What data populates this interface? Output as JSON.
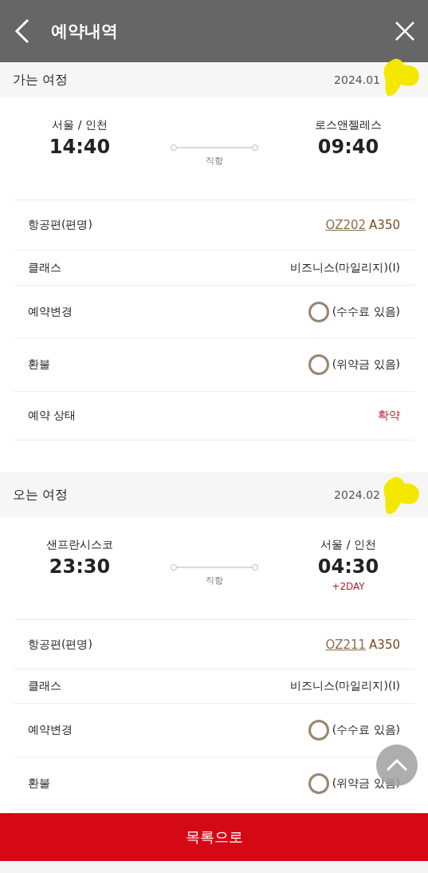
{
  "header": {
    "title": "예약내역"
  },
  "journeys": [
    {
      "title": "가는 여정",
      "date": "2024.01",
      "from": {
        "city": "서울 / 인천",
        "time": "14:40"
      },
      "to": {
        "city": "로스앤젤레스",
        "time": "09:40"
      },
      "route": "직항",
      "rows": [
        {
          "kind": "flight",
          "label": "항공편(편명)",
          "flight": "OZ202",
          "aircraft": "A350"
        },
        {
          "kind": "text",
          "label": "클래스",
          "value": "비즈니스(마일리지)(I)"
        },
        {
          "kind": "option",
          "label": "예약변경",
          "value": "(수수료 있음)",
          "checked": false
        },
        {
          "kind": "option",
          "label": "환불",
          "value": "(위약금 있음)",
          "checked": false
        },
        {
          "kind": "status",
          "label": "예약 상태",
          "value": "확약"
        }
      ]
    },
    {
      "title": "오는 여정",
      "date": "2024.02",
      "from": {
        "city": "샌프란시스코",
        "time": "23:30"
      },
      "to": {
        "city": "서울 / 인천",
        "time": "04:30",
        "note": "+2DAY"
      },
      "route": "직항",
      "rows": [
        {
          "kind": "flight",
          "label": "항공편(편명)",
          "flight": "OZ211",
          "aircraft": "A350"
        },
        {
          "kind": "text",
          "label": "클래스",
          "value": "비즈니스(마일리지)(I)"
        },
        {
          "kind": "option",
          "label": "예약변경",
          "value": "(수수료 있음)",
          "checked": false
        },
        {
          "kind": "option",
          "label": "환불",
          "value": "(위약금 있음)",
          "checked": false
        }
      ]
    }
  ],
  "footer_button": "목록으로"
}
